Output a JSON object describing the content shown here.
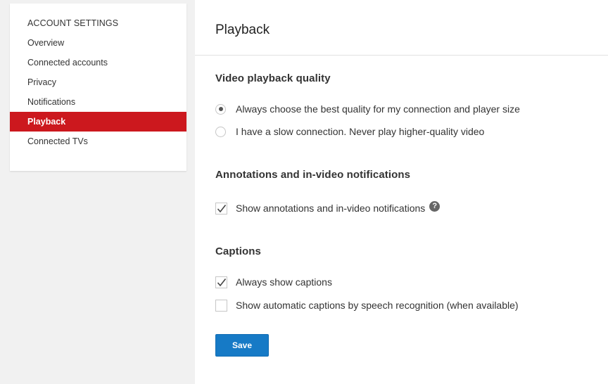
{
  "sidebar": {
    "heading": "ACCOUNT SETTINGS",
    "items": [
      {
        "label": "Overview"
      },
      {
        "label": "Connected accounts"
      },
      {
        "label": "Privacy"
      },
      {
        "label": "Notifications"
      },
      {
        "label": "Playback",
        "active": true
      },
      {
        "label": "Connected TVs"
      }
    ]
  },
  "main": {
    "title": "Playback",
    "playback_quality": {
      "title": "Video playback quality",
      "options": [
        {
          "label": "Always choose the best quality for my connection and player size",
          "selected": true
        },
        {
          "label": "I have a slow connection. Never play higher-quality video",
          "selected": false
        }
      ]
    },
    "annotations": {
      "title": "Annotations and in-video notifications",
      "option": {
        "label": "Show annotations and in-video notifications",
        "checked": true
      },
      "help_icon": "question-circle-icon"
    },
    "captions": {
      "title": "Captions",
      "options": [
        {
          "label": "Always show captions",
          "checked": true
        },
        {
          "label": "Show automatic captions by speech recognition (when available)",
          "checked": false
        }
      ]
    },
    "save_label": "Save"
  },
  "colors": {
    "accent": "#cc181e",
    "button": "#167ac6",
    "background": "#f1f1f1"
  }
}
